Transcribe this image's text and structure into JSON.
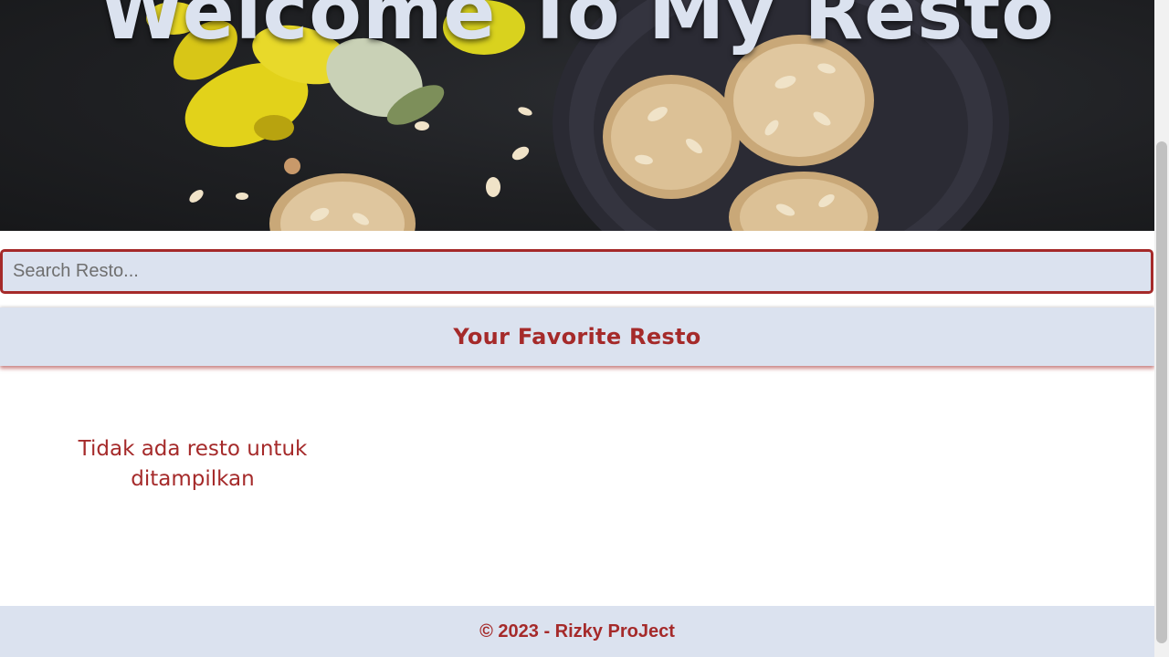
{
  "hero": {
    "title": "Welcome To My Resto",
    "image": "cookies-and-daffodils-photo"
  },
  "search": {
    "placeholder": "Search Resto...",
    "value": ""
  },
  "favorites": {
    "title": "Your Favorite Resto",
    "empty_message": "Tidak ada resto untuk ditampilkan"
  },
  "footer": {
    "text": "© 2023 - Rizky ProJect"
  },
  "colors": {
    "accent": "#a52a2a",
    "panel": "#dbe2ef",
    "hero_bg": "#1f2023"
  }
}
